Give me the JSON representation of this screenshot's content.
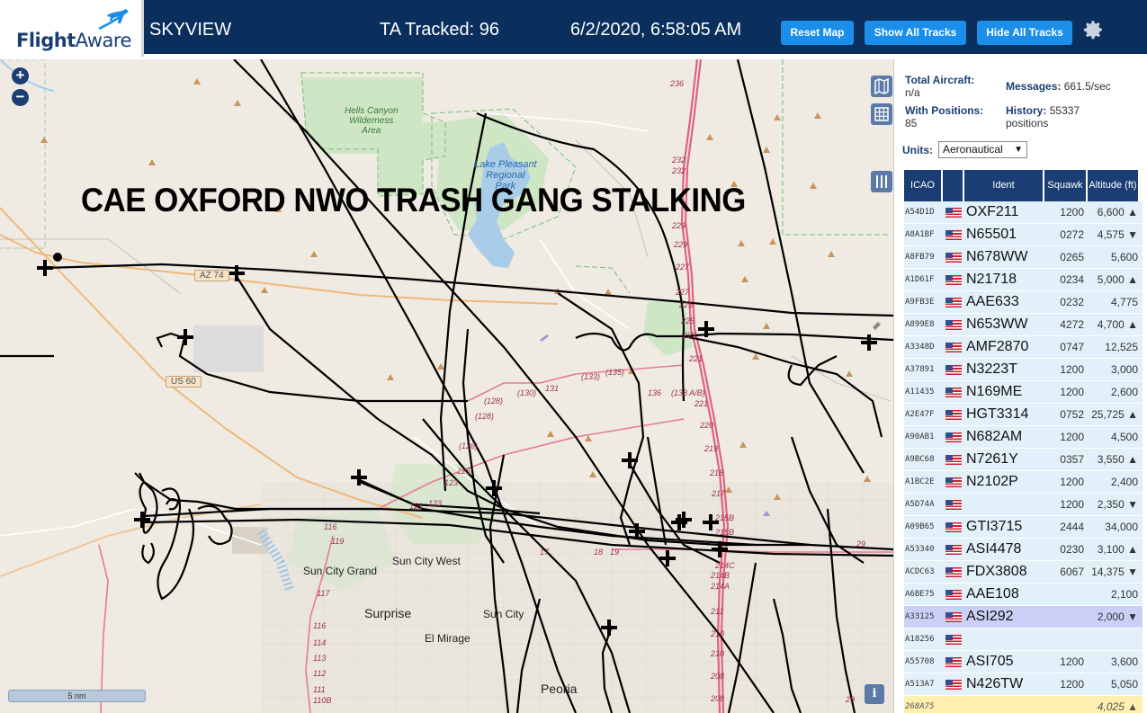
{
  "header": {
    "logo": "FlightAware",
    "app_name": "SKYVIEW",
    "tracked": "TA Tracked: 96",
    "datetime": "6/2/2020, 6:58:05 AM",
    "buttons": {
      "reset": "Reset Map",
      "show_all": "Show All Tracks",
      "hide_all": "Hide All Tracks"
    }
  },
  "map": {
    "zoom_in": "+",
    "zoom_out": "−",
    "overlay_text": "CAE OXFORD NWO TRASH GANG STALKING",
    "scale": "5 nm",
    "info": "i",
    "labels": {
      "hells_canyon": "Hells Canyon\nWilderness\nArea",
      "lake_pleasant": "Lake Pleasant\nRegional\nPark",
      "sun_city_grand": "Sun City Grand",
      "sun_city_west": "Sun City West",
      "surprise": "Surprise",
      "sun_city": "Sun City",
      "el_mirage": "El Mirage",
      "peoria": "Peoria",
      "az74": "AZ 74",
      "us60": "US 60"
    }
  },
  "sidebar": {
    "total_aircraft_label": "Total Aircraft:",
    "total_aircraft_value": "n/a",
    "with_positions_label": "With Positions:",
    "with_positions_value": "85",
    "messages_label": "Messages:",
    "messages_value": "661.5/sec",
    "history_label": "History:",
    "history_value": "55337",
    "history_unit": "positions",
    "units_label": "Units:",
    "units_value": "Aeronautical"
  },
  "table": {
    "headers": {
      "icao": "ICAO",
      "ident": "Ident",
      "squawk": "Squawk",
      "altitude": "Altitude (ft)"
    },
    "rows": [
      {
        "icao": "A54D1D",
        "ident": "OXF211",
        "squawk": "1200",
        "alt": "6,600 ▲"
      },
      {
        "icao": "A8A1BF",
        "ident": "N65501",
        "squawk": "0272",
        "alt": "4,575 ▼"
      },
      {
        "icao": "A8FB79",
        "ident": "N678WW",
        "squawk": "0265",
        "alt": "5,600"
      },
      {
        "icao": "A1D61F",
        "ident": "N21718",
        "squawk": "0234",
        "alt": "5,000 ▲"
      },
      {
        "icao": "A9FB3E",
        "ident": "AAE633",
        "squawk": "0232",
        "alt": "4,775"
      },
      {
        "icao": "A899E8",
        "ident": "N653WW",
        "squawk": "4272",
        "alt": "4,700 ▲"
      },
      {
        "icao": "A3348D",
        "ident": "AMF2870",
        "squawk": "0747",
        "alt": "12,525"
      },
      {
        "icao": "A37891",
        "ident": "N3223T",
        "squawk": "1200",
        "alt": "3,000"
      },
      {
        "icao": "A11435",
        "ident": "N169ME",
        "squawk": "1200",
        "alt": "2,600"
      },
      {
        "icao": "A2E47F",
        "ident": "HGT3314",
        "squawk": "0752",
        "alt": "25,725 ▲"
      },
      {
        "icao": "A90AB1",
        "ident": "N682AM",
        "squawk": "1200",
        "alt": "4,500"
      },
      {
        "icao": "A9BC68",
        "ident": "N7261Y",
        "squawk": "0357",
        "alt": "3,550 ▲"
      },
      {
        "icao": "A1BC2E",
        "ident": "N2102P",
        "squawk": "1200",
        "alt": "2,400"
      },
      {
        "icao": "A5D74A",
        "ident": "",
        "squawk": "1200",
        "alt": "2,350 ▼"
      },
      {
        "icao": "A09B65",
        "ident": "GTI3715",
        "squawk": "2444",
        "alt": "34,000"
      },
      {
        "icao": "A53340",
        "ident": "ASI4478",
        "squawk": "0230",
        "alt": "3,100 ▲"
      },
      {
        "icao": "ACDC63",
        "ident": "FDX3808",
        "squawk": "6067",
        "alt": "14,375 ▼"
      },
      {
        "icao": "A6BE75",
        "ident": "AAE108",
        "squawk": "",
        "alt": "2,100"
      },
      {
        "icao": "A33125",
        "ident": "ASI292",
        "squawk": "",
        "alt": "2,000 ▼"
      },
      {
        "icao": "A18256",
        "ident": "",
        "squawk": "",
        "alt": ""
      },
      {
        "icao": "A55708",
        "ident": "ASI705",
        "squawk": "1200",
        "alt": "3,600"
      },
      {
        "icao": "A513A7",
        "ident": "N426TW",
        "squawk": "1200",
        "alt": "5,050"
      },
      {
        "icao": "268A75",
        "ident": "",
        "squawk": "",
        "alt": "4,025 ▲"
      }
    ]
  },
  "colors": {
    "header_bg": "#0a2f5c",
    "button_blue": "#1a8ee8",
    "table_header": "#1a3e73",
    "row_bg": "#e2f0fa",
    "selected_row": "#ccd0f7",
    "map_bg": "#efebe3"
  }
}
